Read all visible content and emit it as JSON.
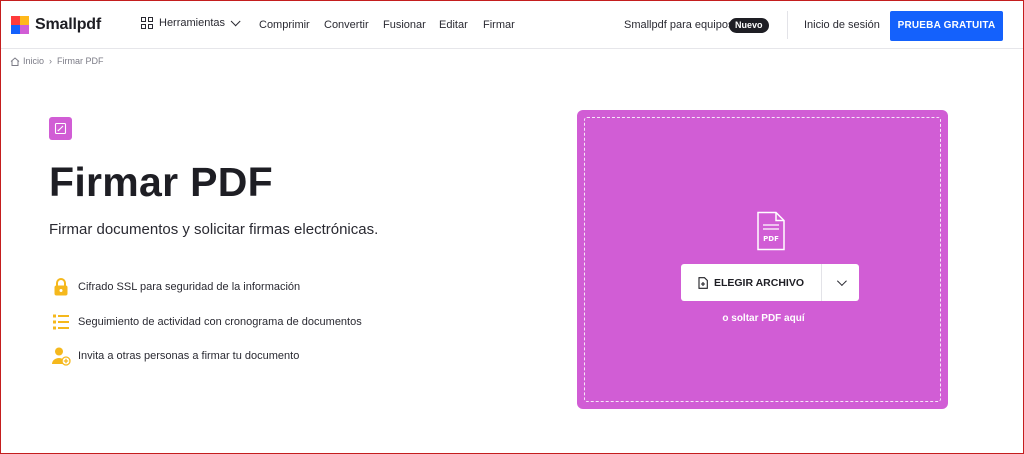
{
  "header": {
    "brand": "Smallpdf",
    "tools_label": "Herramientas",
    "nav": [
      "Comprimir",
      "Convertir",
      "Fusionar",
      "Editar",
      "Firmar"
    ],
    "teams_label": "Smallpdf para equipos",
    "teams_badge": "Nuevo",
    "login_label": "Inicio de sesión",
    "trial_button": "PRUEBA GRATUITA"
  },
  "breadcrumb": {
    "home": "Inicio",
    "separator": "›",
    "current": "Firmar PDF"
  },
  "main": {
    "title": "Firmar PDF",
    "subtitle": "Firmar documentos y solicitar firmas electrónicas.",
    "features": [
      {
        "icon": "lock-icon",
        "text": "Cifrado SSL para seguridad de la información"
      },
      {
        "icon": "timeline-list-icon",
        "text": "Seguimiento de actividad con cronograma de documentos"
      },
      {
        "icon": "add-user-icon",
        "text": "Invita a otras personas a firmar tu documento"
      }
    ]
  },
  "dropzone": {
    "file_icon_label": "PDF",
    "choose_button": "ELEGIR ARCHIVO",
    "drop_hint": "o soltar PDF aquí"
  },
  "colors": {
    "accent": "#d15dd5",
    "primary_button": "#1461fc",
    "feature_icon": "#f5b81c",
    "text": "#1e1e24"
  }
}
